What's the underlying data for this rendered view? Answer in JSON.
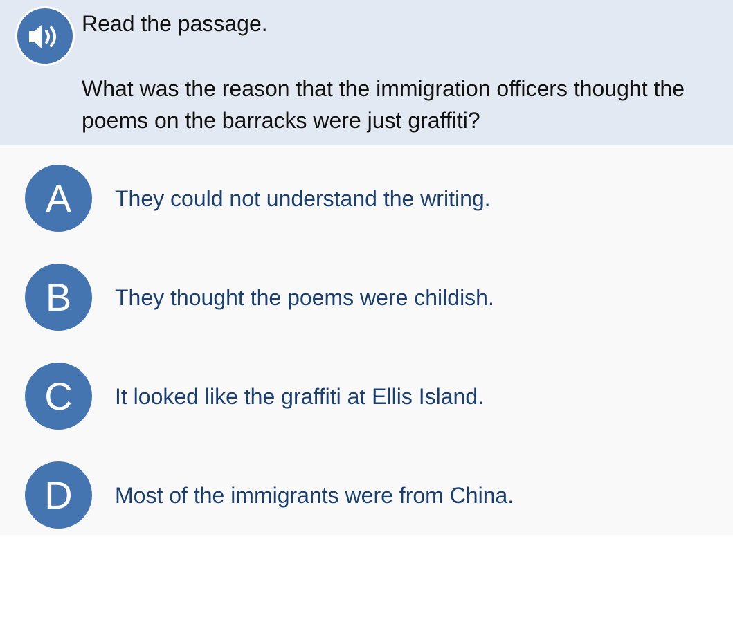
{
  "header": {
    "audio_icon": "speaker-volume-icon",
    "instruction": "Read the passage.",
    "question": "What was the reason that the immigration officers thought the poems on the barracks were just graffiti?"
  },
  "choices": [
    {
      "letter": "A",
      "text": "They could not understand the writing."
    },
    {
      "letter": "B",
      "text": "They thought the poems were childish."
    },
    {
      "letter": "C",
      "text": "It looked like the graffiti at Ellis Island."
    },
    {
      "letter": "D",
      "text": "Most of the immigrants were from China."
    }
  ],
  "colors": {
    "question_bg": "#e3e9f3",
    "answers_bg": "#f9f9f9",
    "accent_blue": "#4475b0",
    "choice_text": "#1a3f73"
  }
}
